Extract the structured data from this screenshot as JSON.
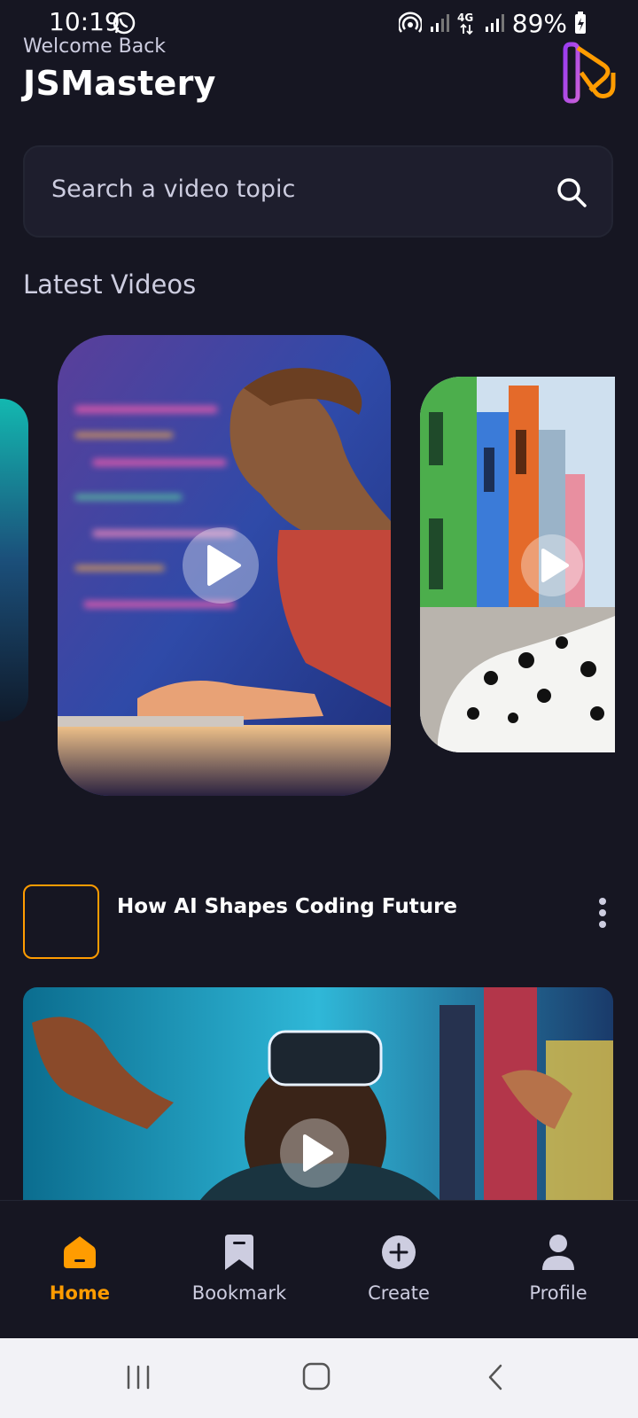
{
  "status_bar": {
    "time": "10:19",
    "battery": "89%",
    "network": "4G"
  },
  "header": {
    "welcome": "Welcome Back",
    "username": "JSMastery"
  },
  "search": {
    "placeholder": "Search a video topic"
  },
  "latest": {
    "title": "Latest Videos"
  },
  "video": {
    "title": "How AI Shapes Coding Future"
  },
  "tabs": [
    {
      "label": "Home",
      "icon": "home-icon",
      "active": true
    },
    {
      "label": "Bookmark",
      "icon": "bookmark-icon",
      "active": false
    },
    {
      "label": "Create",
      "icon": "plus-circle-icon",
      "active": false
    },
    {
      "label": "Profile",
      "icon": "profile-icon",
      "active": false
    }
  ],
  "colors": {
    "background": "#161622",
    "accent": "#FF9C01",
    "muted": "#CDCDE0",
    "card": "#1E1E2D"
  }
}
